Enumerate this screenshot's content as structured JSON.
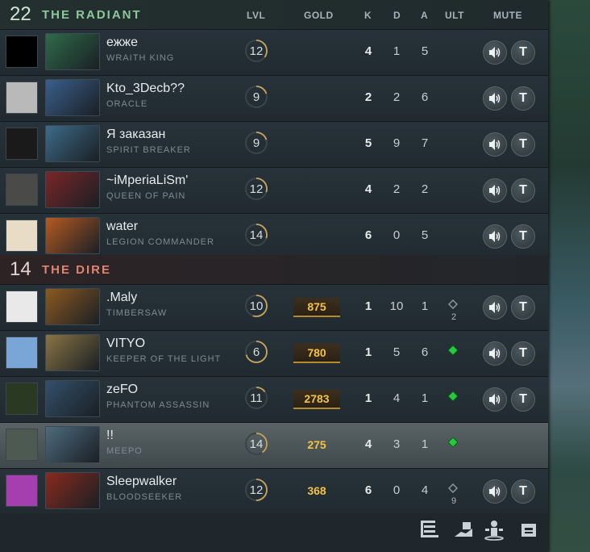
{
  "columns": {
    "lvl": "LVL",
    "gold": "GOLD",
    "k": "K",
    "d": "D",
    "a": "A",
    "ult": "ULT",
    "mute": "MUTE"
  },
  "radiant": {
    "score": "22",
    "name": "THE RADIANT",
    "players": [
      {
        "player": "ежже",
        "hero": "WRAITH KING",
        "level": "12",
        "level_progress": 0.35,
        "gold": "",
        "k": "4",
        "d": "1",
        "a": "5",
        "ult": "",
        "ult_cd": "",
        "hero_color": "#2f6b4a",
        "avatar_color": "#000000"
      },
      {
        "player": "Kto_3Decb??",
        "hero": "ORACLE",
        "level": "9",
        "level_progress": 0.2,
        "gold": "",
        "k": "2",
        "d": "2",
        "a": "6",
        "ult": "",
        "ult_cd": "",
        "hero_color": "#3a5f8c",
        "avatar_color": "#b9b9b9"
      },
      {
        "player": "Я заказан",
        "hero": "SPIRIT BREAKER",
        "level": "9",
        "level_progress": 0.2,
        "gold": "",
        "k": "5",
        "d": "9",
        "a": "7",
        "ult": "",
        "ult_cd": "",
        "hero_color": "#3d6b88",
        "avatar_color": "#1a1a1a"
      },
      {
        "player": "~iMperiaLiSm'",
        "hero": "QUEEN OF PAIN",
        "level": "12",
        "level_progress": 0.3,
        "gold": "",
        "k": "4",
        "d": "2",
        "a": "2",
        "ult": "",
        "ult_cd": "",
        "hero_color": "#7a2628",
        "avatar_color": "#4a4a48"
      },
      {
        "player": "water",
        "hero": "LEGION COMMANDER",
        "level": "14",
        "level_progress": 0.3,
        "gold": "",
        "k": "6",
        "d": "0",
        "a": "5",
        "ult": "",
        "ult_cd": "",
        "hero_color": "#b55a22",
        "avatar_color": "#e8dcc6"
      }
    ]
  },
  "dire": {
    "score": "14",
    "name": "THE DIRE",
    "players": [
      {
        "player": ".Maly",
        "hero": "TIMBERSAW",
        "level": "10",
        "level_progress": 0.55,
        "gold": "875",
        "k": "1",
        "d": "10",
        "a": "1",
        "ult": "cooldown",
        "ult_cd": "2",
        "hero_color": "#8c5a20",
        "avatar_color": "#e9e9e9"
      },
      {
        "player": "VITYO",
        "hero": "KEEPER OF THE LIGHT",
        "level": "6",
        "level_progress": 0.7,
        "gold": "780",
        "k": "1",
        "d": "5",
        "a": "6",
        "ult": "ready",
        "ult_cd": "",
        "hero_color": "#8a7444",
        "avatar_color": "#7aa6d6"
      },
      {
        "player": "zeFO",
        "hero": "PHANTOM ASSASSIN",
        "level": "11",
        "level_progress": 0.15,
        "gold": "2783",
        "k": "1",
        "d": "4",
        "a": "1",
        "ult": "ready",
        "ult_cd": "",
        "hero_color": "#33506a",
        "avatar_color": "#2a3a22"
      },
      {
        "player": "!!",
        "hero": "MEEPO",
        "level": "14",
        "level_progress": 0.4,
        "gold": "275",
        "k": "4",
        "d": "3",
        "a": "1",
        "ult": "ready",
        "ult_cd": "",
        "hero_color": "#4e6b7e",
        "avatar_color": "#4d5a52"
      },
      {
        "player": "Sleepwalker",
        "hero": "BLOODSEEKER",
        "level": "12",
        "level_progress": 0.5,
        "gold": "368",
        "k": "6",
        "d": "0",
        "a": "4",
        "ult": "cooldown",
        "ult_cd": "9",
        "hero_color": "#8a2a1e",
        "avatar_color": "#a53fb0"
      }
    ]
  },
  "bottom_icons": [
    "list-report-icon",
    "courier-icon",
    "pause-player-icon",
    "shop-icon"
  ]
}
